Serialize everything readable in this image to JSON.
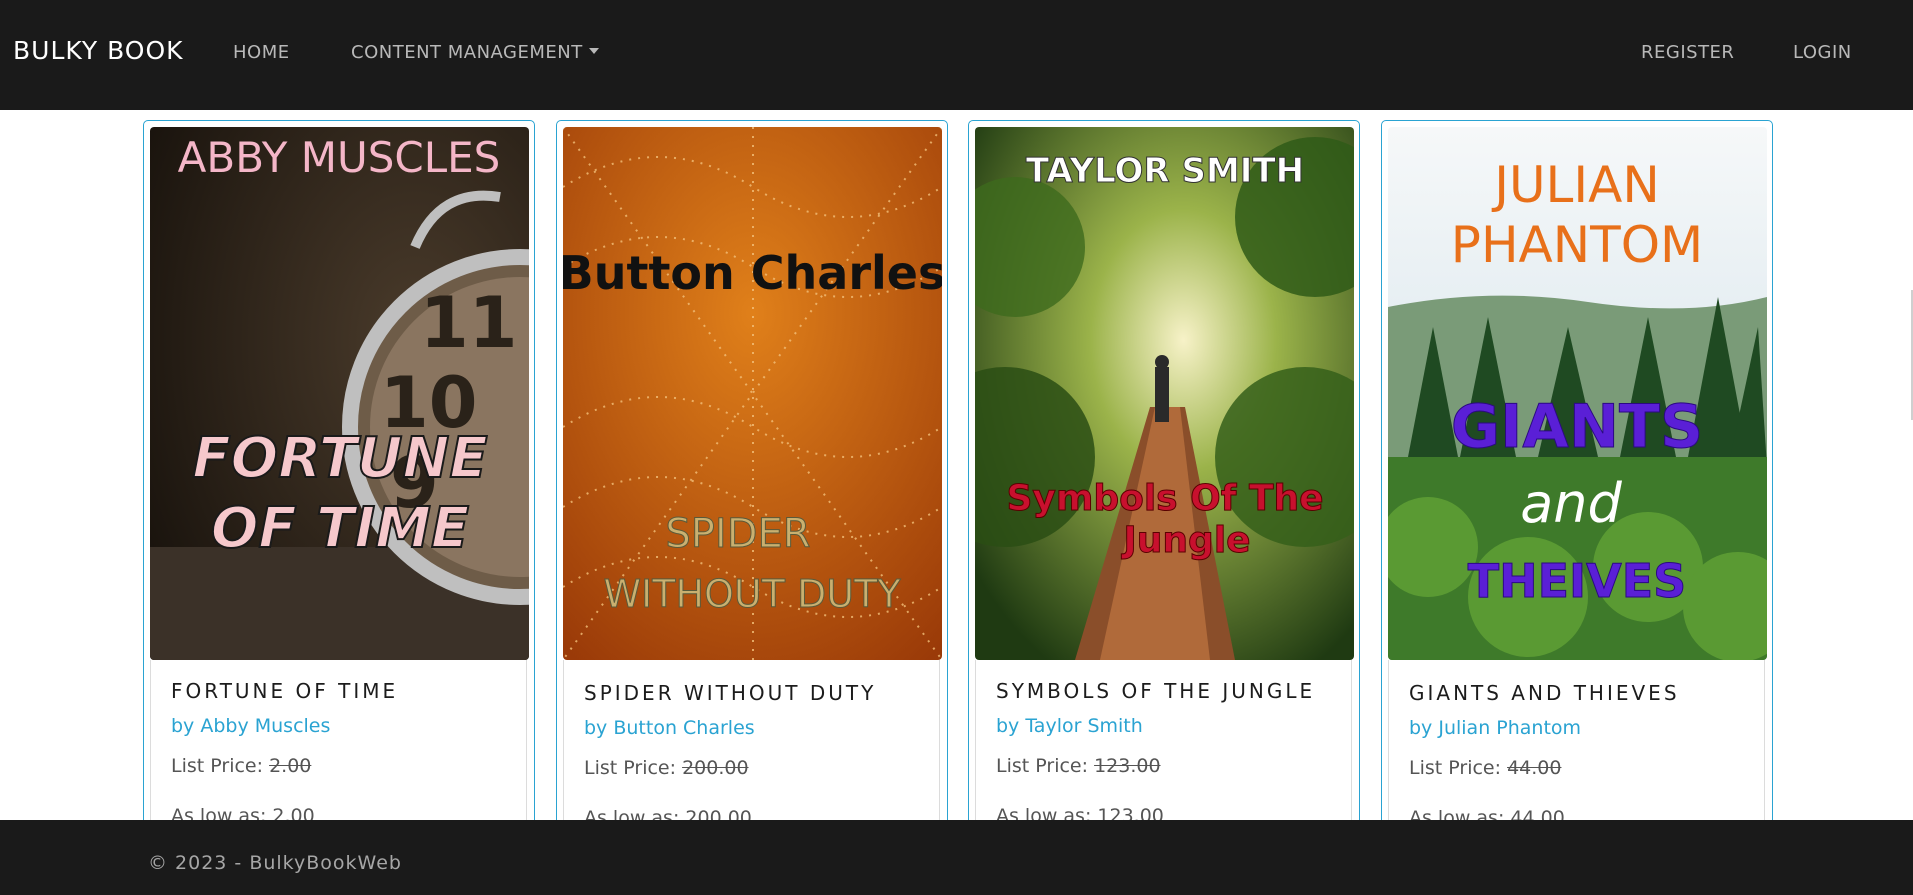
{
  "navbar": {
    "brand": "BULKY BOOK",
    "home": "HOME",
    "content_management": "CONTENT MANAGEMENT",
    "register": "REGISTER",
    "login": "LOGIN"
  },
  "products": [
    {
      "title": "FORTUNE OF TIME",
      "author": "by Abby Muscles",
      "list_price_label": "List Price:",
      "list_price": "2.00",
      "as_low_as": "As low as: 2.00",
      "cover": {
        "author_text": "ABBY MUSCLES",
        "title_line1": "FORTUNE",
        "title_line2": "OF TIME"
      }
    },
    {
      "title": "SPIDER WITHOUT DUTY",
      "author": "by Button Charles",
      "list_price_label": "List Price:",
      "list_price": "200.00",
      "as_low_as": "As low as: 200.00",
      "cover": {
        "author_text": "Button Charles",
        "title_line1": "SPIDER",
        "title_line2": "WITHOUT DUTY"
      }
    },
    {
      "title": "SYMBOLS OF THE JUNGLE",
      "author": "by Taylor Smith",
      "list_price_label": "List Price:",
      "list_price": "123.00",
      "as_low_as": "As low as: 123.00",
      "cover": {
        "author_text": "TAYLOR SMITH",
        "title_line1": "Symbols Of The",
        "title_line2": "Jungle"
      }
    },
    {
      "title": "GIANTS AND THIEVES",
      "author": "by Julian Phantom",
      "list_price_label": "List Price:",
      "list_price": "44.00",
      "as_low_as": "As low as: 44.00",
      "cover": {
        "author_line1": "JULIAN",
        "author_line2": "PHANTOM",
        "title_line1": "GIANTS",
        "title_line2": "and",
        "title_line3": "THEIVES"
      }
    }
  ],
  "footer": {
    "copyright": "© 2023 - BulkyBookWeb"
  },
  "colors": {
    "navbar_bg": "#1a1a1a",
    "accent": "#2aa3d2"
  }
}
